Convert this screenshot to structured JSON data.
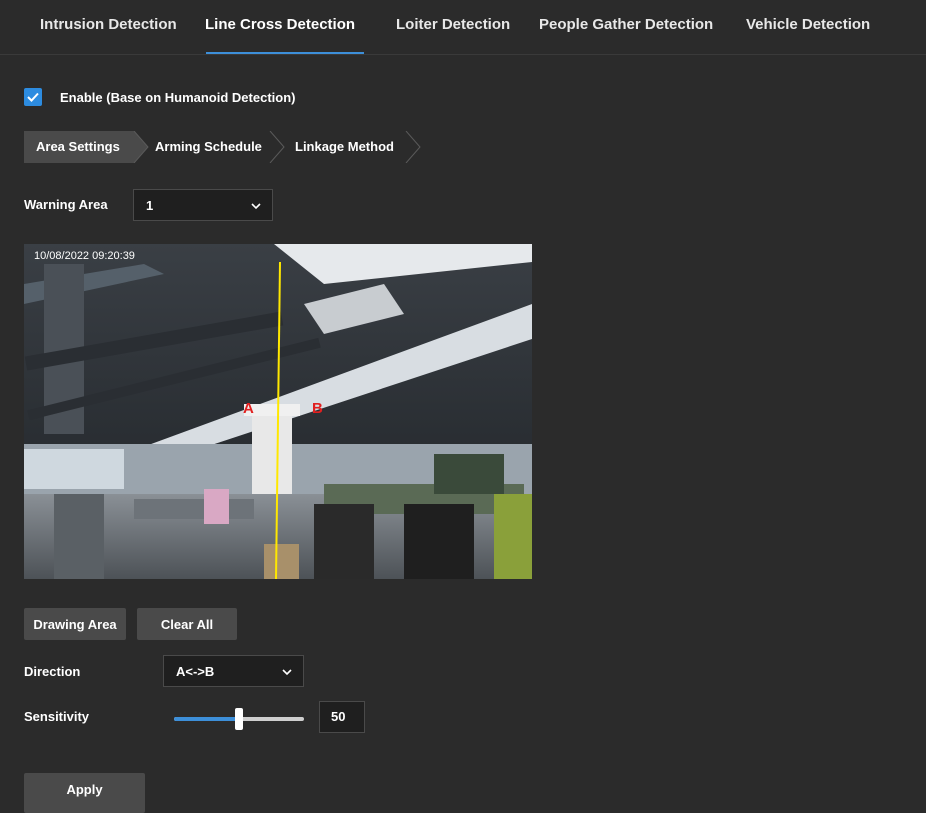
{
  "tabs": [
    {
      "label": "Intrusion Detection"
    },
    {
      "label": "Line Cross Detection"
    },
    {
      "label": "Loiter Detection"
    },
    {
      "label": "People Gather Detection"
    },
    {
      "label": "Vehicle Detection"
    }
  ],
  "active_tab": 1,
  "enable": {
    "label": "Enable (Base on Humanoid Detection)",
    "checked": true
  },
  "steps": [
    {
      "label": "Area Settings",
      "active": true
    },
    {
      "label": "Arming Schedule",
      "active": false
    },
    {
      "label": "Linkage Method",
      "active": false
    }
  ],
  "warning_area": {
    "label": "Warning Area",
    "value": "1"
  },
  "camera": {
    "timestamp": "10/08/2022 09:20:39",
    "label_a": "A",
    "label_b": "B"
  },
  "buttons": {
    "drawing_area": "Drawing Area",
    "clear_all": "Clear All",
    "apply": "Apply"
  },
  "direction": {
    "label": "Direction",
    "value": "A<->B"
  },
  "sensitivity": {
    "label": "Sensitivity",
    "value": "50",
    "fraction": 0.5
  },
  "colors": {
    "accent": "#3d8fd9",
    "line": "#ffe800",
    "labels": "#e02020"
  }
}
